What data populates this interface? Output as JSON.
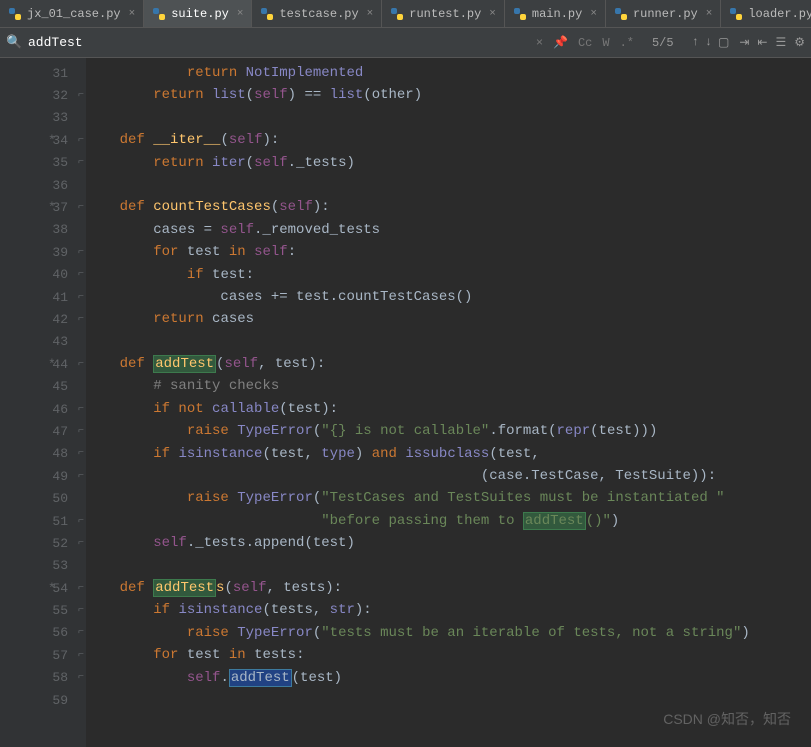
{
  "tabs": [
    {
      "label": "jx_01_case.py",
      "active": false
    },
    {
      "label": "suite.py",
      "active": true
    },
    {
      "label": "testcase.py",
      "active": false
    },
    {
      "label": "runtest.py",
      "active": false
    },
    {
      "label": "main.py",
      "active": false
    },
    {
      "label": "runner.py",
      "active": false
    },
    {
      "label": "loader.py",
      "active": false
    }
  ],
  "find": {
    "query": "addTest",
    "count": "5/5",
    "tools": {
      "cc": "Cc",
      "w": "W",
      "regex": ".*"
    }
  },
  "lines": [
    {
      "n": "31",
      "mod": "",
      "fold": "",
      "html": "            <span class='kw'>return</span> <span class='builtin'>NotImplemented</span>"
    },
    {
      "n": "32",
      "mod": "",
      "fold": "⌐",
      "html": "        <span class='kw'>return</span> <span class='builtin'>list</span>(<span class='self'>self</span>) == <span class='builtin'>list</span>(other)"
    },
    {
      "n": "33",
      "mod": "",
      "fold": "",
      "html": ""
    },
    {
      "n": "34",
      "mod": "*",
      "fold": "⌐",
      "html": "    <span class='kw'>def</span> <span class='fn'>__iter__</span>(<span class='self'>self</span>):"
    },
    {
      "n": "35",
      "mod": "",
      "fold": "⌐",
      "html": "        <span class='kw'>return</span> <span class='builtin'>iter</span>(<span class='self'>self</span>._tests)"
    },
    {
      "n": "36",
      "mod": "",
      "fold": "",
      "html": ""
    },
    {
      "n": "37",
      "mod": "*",
      "fold": "⌐",
      "html": "    <span class='kw'>def</span> <span class='fn'>countTestCases</span>(<span class='self'>self</span>):"
    },
    {
      "n": "38",
      "mod": "",
      "fold": "",
      "html": "        cases = <span class='self'>self</span>._removed_tests"
    },
    {
      "n": "39",
      "mod": "",
      "fold": "⌐",
      "html": "        <span class='kw'>for</span> test <span class='kw'>in</span> <span class='self'>self</span>:"
    },
    {
      "n": "40",
      "mod": "",
      "fold": "⌐",
      "html": "            <span class='kw'>if</span> test:"
    },
    {
      "n": "41",
      "mod": "",
      "fold": "⌐",
      "html": "                cases += test.countTestCases()"
    },
    {
      "n": "42",
      "mod": "",
      "fold": "⌐",
      "html": "        <span class='kw'>return</span> cases"
    },
    {
      "n": "43",
      "mod": "",
      "fold": "",
      "html": ""
    },
    {
      "n": "44",
      "mod": "*",
      "fold": "⌐",
      "html": "    <span class='kw'>def</span> <span class='fn'><span class='hl'>addTest</span></span>(<span class='self'>self</span>, test):"
    },
    {
      "n": "45",
      "mod": "",
      "fold": "",
      "html": "        <span class='cmt'># sanity checks</span>"
    },
    {
      "n": "46",
      "mod": "",
      "fold": "⌐",
      "html": "        <span class='kw'>if not</span> <span class='builtin'>callable</span>(test):"
    },
    {
      "n": "47",
      "mod": "",
      "fold": "⌐",
      "html": "            <span class='kw'>raise</span> <span class='builtin'>TypeError</span>(<span class='str'>\"{} is not callable\"</span>.format(<span class='builtin'>repr</span>(test)))"
    },
    {
      "n": "48",
      "mod": "",
      "fold": "⌐",
      "html": "        <span class='kw'>if</span> <span class='builtin'>isinstance</span>(test, <span class='builtin'>type</span>) <span class='kw'>and</span> <span class='builtin'>issubclass</span>(test,"
    },
    {
      "n": "49",
      "mod": "",
      "fold": "⌐",
      "html": "                                               (case.TestCase, TestSuite)):"
    },
    {
      "n": "50",
      "mod": "",
      "fold": "",
      "html": "            <span class='kw'>raise</span> <span class='builtin'>TypeError</span>(<span class='str'>\"TestCases and TestSuites must be instantiated \"</span>"
    },
    {
      "n": "51",
      "mod": "",
      "fold": "⌐",
      "html": "                            <span class='str'>\"before passing them to <span class='hl'>addTest</span>()\"</span>)"
    },
    {
      "n": "52",
      "mod": "",
      "fold": "⌐",
      "html": "        <span class='self'>self</span>._tests.append(test)"
    },
    {
      "n": "53",
      "mod": "",
      "fold": "",
      "html": ""
    },
    {
      "n": "54",
      "mod": "*",
      "fold": "⌐",
      "html": "    <span class='kw'>def</span> <span class='fn'><span class='hl'>addTest</span>s</span>(<span class='self'>self</span>, tests):"
    },
    {
      "n": "55",
      "mod": "",
      "fold": "⌐",
      "html": "        <span class='kw'>if</span> <span class='builtin'>isinstance</span>(tests, <span class='builtin'>str</span>):"
    },
    {
      "n": "56",
      "mod": "",
      "fold": "⌐",
      "html": "            <span class='kw'>raise</span> <span class='builtin'>TypeError</span>(<span class='str'>\"tests must be an iterable of tests, not a string\"</span>)"
    },
    {
      "n": "57",
      "mod": "",
      "fold": "⌐",
      "html": "        <span class='kw'>for</span> test <span class='kw'>in</span> tests:"
    },
    {
      "n": "58",
      "mod": "",
      "fold": "⌐",
      "html": "            <span class='self'>self</span>.<span class='hlbox'>addTest</span>(test)"
    },
    {
      "n": "59",
      "mod": "",
      "fold": "",
      "html": ""
    }
  ],
  "watermark": "CSDN @知否，知否"
}
